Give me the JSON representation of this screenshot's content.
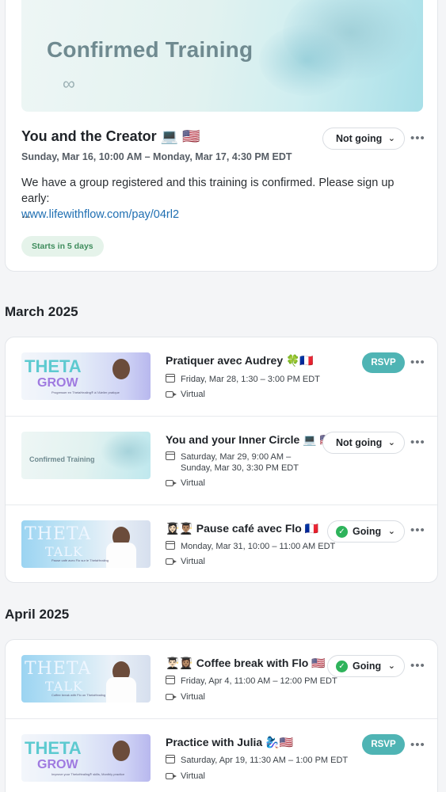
{
  "featured": {
    "hero_title": "Confirmed Training",
    "title": "You and the Creator 💻 🇺🇸",
    "date": "Sunday, Mar 16, 10:00 AM – Monday, Mar 17, 4:30 PM EDT",
    "description": "We have a group registered and this training is confirmed. Please sign up early:",
    "link": "www.lifewithflow.com/pay/04rl2",
    "ellipsis": "...",
    "badge": "Starts in 5 days",
    "rsvp_status": "Not going"
  },
  "sections": [
    {
      "heading": "March 2025",
      "events": [
        {
          "thumb": {
            "style": "grow",
            "word1": "THETA",
            "word2": "GROW",
            "tiny": "Progresser en ThetaHealing® à l'Atelier pratique"
          },
          "title": "Pratiquer avec Audrey 🍀🇫🇷",
          "date": "Friday, Mar 28, 1:30 – 3:00 PM EDT",
          "location": "Virtual",
          "action": "RSVP"
        },
        {
          "thumb": {
            "style": "conf",
            "word1": "Confirmed Training"
          },
          "title": "You and your Inner Circle 💻 🇺🇸",
          "date": "Saturday, Mar 29, 9:00 AM – Sunday, Mar 30, 3:30 PM EDT",
          "location": "Virtual",
          "action": "Not going"
        },
        {
          "thumb": {
            "style": "talk",
            "word1": "THETA",
            "word2": "TALK",
            "tiny": "Pause café avec Flo sur le ThetaHealing"
          },
          "title": "👩🏻‍🎓👨🏽‍🎓 Pause café avec Flo 🇫🇷",
          "date": "Monday, Mar 31, 10:00 – 11:00 AM EDT",
          "location": "Virtual",
          "action": "Going"
        }
      ]
    },
    {
      "heading": "April 2025",
      "events": [
        {
          "thumb": {
            "style": "talk",
            "word1": "THETA",
            "word2": "TALK",
            "tiny": "Coffee break with Flo on ThetaHealing"
          },
          "title": "👨🏻‍🎓👩🏽‍🎓 Coffee break with Flo 🇺🇸",
          "date": "Friday, Apr 4, 11:00 AM – 12:00 PM EDT",
          "location": "Virtual",
          "action": "Going"
        },
        {
          "thumb": {
            "style": "grow",
            "word1": "THETA",
            "word2": "GROW",
            "tiny": "Improve your ThetaHealing® skills, Monthly practice"
          },
          "title": "Practice with Julia 🧞‍♀️🇺🇸",
          "date": "Saturday, Apr 19, 11:30 AM – 1:00 PM EDT",
          "location": "Virtual",
          "action": "RSVP"
        }
      ]
    }
  ],
  "icons": {
    "more": "more-icon",
    "chevron": "chevron-down-icon",
    "calendar": "calendar-icon",
    "video": "video-icon",
    "check": "check-icon"
  },
  "colors": {
    "rsvp": "#4fb4b4",
    "going_check": "#2eb35b",
    "badge_bg": "#e5f3ea",
    "badge_text": "#3e8c5c",
    "link": "#1f6fb2"
  }
}
